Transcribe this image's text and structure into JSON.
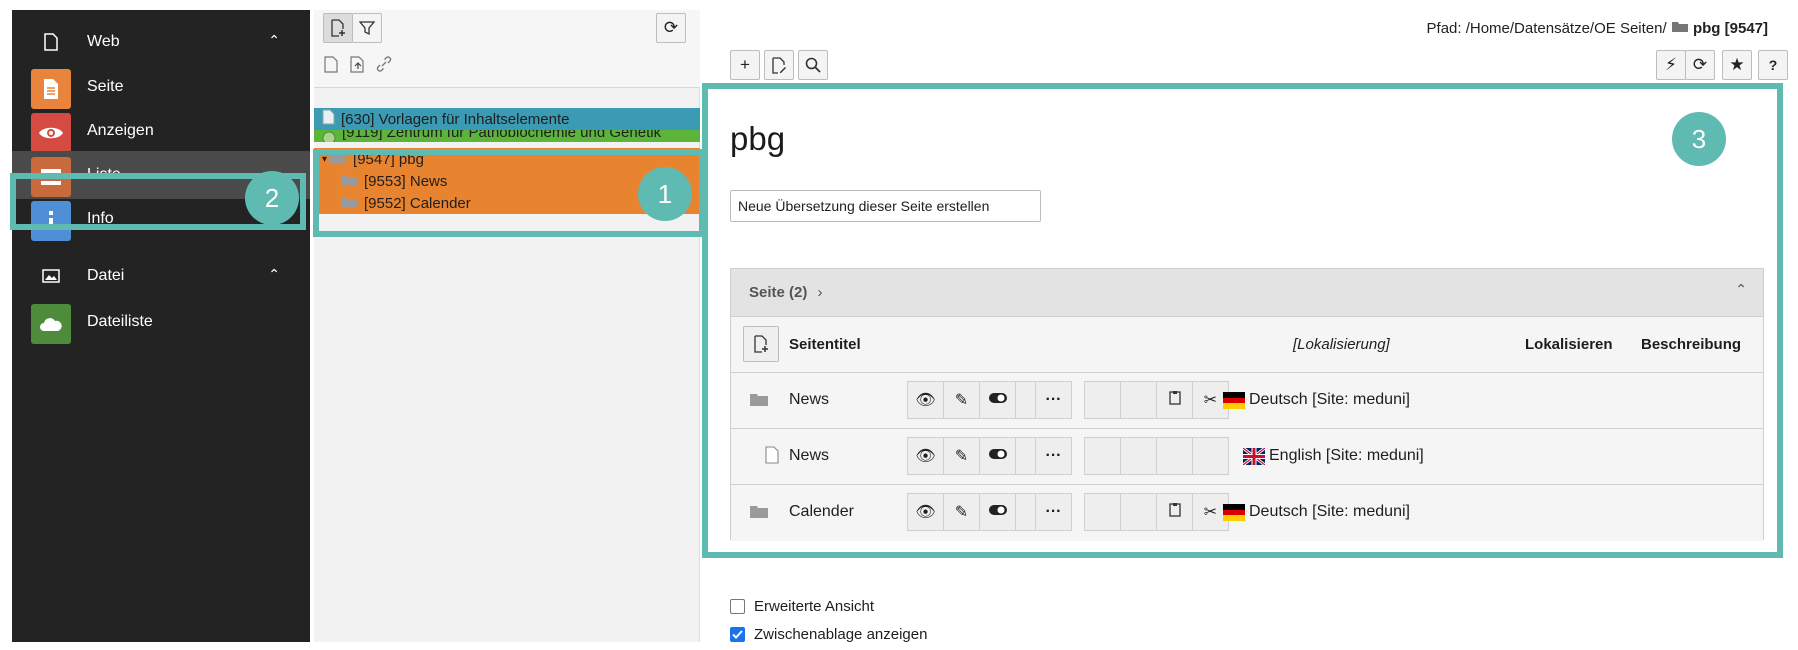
{
  "module_menu": {
    "web_group": "Web",
    "items_web": [
      {
        "label": "Seite",
        "color": "#e8843b"
      },
      {
        "label": "Anzeigen",
        "color": "#d64b41"
      },
      {
        "label": "Liste",
        "color": "#c86a3b"
      },
      {
        "label": "Info",
        "color": "#4f8fd6"
      }
    ],
    "file_group": "Datei",
    "items_file": [
      {
        "label": "Dateiliste",
        "color": "#4e8c3c"
      }
    ]
  },
  "tree": {
    "rows": [
      {
        "label": "[630] Vorlagen für Inhaltselemente",
        "bg": "#3b9bb5"
      },
      {
        "label": "[9119] Zentrum für Pathobiochemie und Genetik",
        "bg": "#5cb43a"
      },
      {
        "label": "[9547] pbg",
        "bg": "#e8842f"
      },
      {
        "label": "[9553] News",
        "bg": "#e8842f"
      },
      {
        "label": "[9552] Calender",
        "bg": "#e8842f"
      }
    ]
  },
  "header": {
    "path_label": "Pfad: /Home/Datensätze/OE Seiten/",
    "path_current": "pbg [9547]"
  },
  "main": {
    "page_title": "pbg",
    "translate_button": "Neue Übersetzung dieser Seite erstellen",
    "panel_title": "Seite (2)",
    "columns": {
      "title": "Seitentitel",
      "localization": "[Lokalisierung]",
      "localize": "Lokalisieren",
      "description": "Beschreibung"
    },
    "rows": [
      {
        "title": "News",
        "language": "Deutsch [Site: meduni]",
        "flag": "de"
      },
      {
        "title": "News",
        "language": "English [Site: meduni]",
        "flag": "en"
      },
      {
        "title": "Calender",
        "language": "Deutsch [Site: meduni]",
        "flag": "de"
      }
    ],
    "checkboxes": [
      {
        "label": "Erweiterte Ansicht",
        "checked": false
      },
      {
        "label": "Zwischenablage anzeigen",
        "checked": true
      }
    ]
  },
  "annotations": {
    "badge1": "1",
    "badge2": "2",
    "badge3": "3",
    "color": "#5fbab2"
  }
}
